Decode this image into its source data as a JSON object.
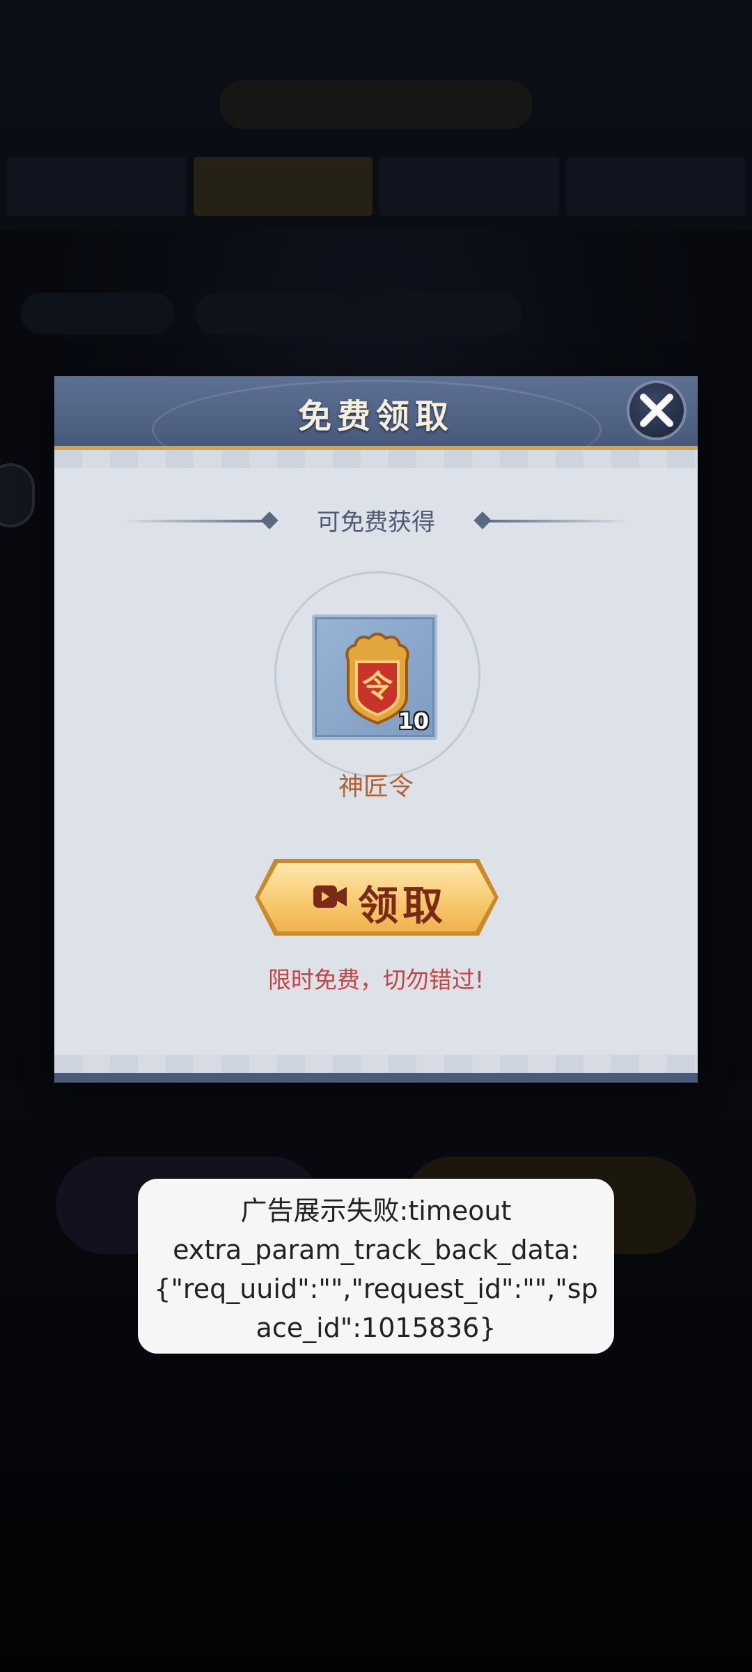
{
  "modal": {
    "title": "免费领取",
    "section_title": "可免费获得",
    "item": {
      "name": "神匠令",
      "count": "10",
      "glyph": "令"
    },
    "claim_button_label": "领取",
    "limit_text": "限时免费，切勿错过!"
  },
  "toast": {
    "lines": [
      "广告展示失败:timeout",
      "extra_param_track_back_data:",
      "{\"req_uuid\":\"\",\"request_id\":\"\",\"sp",
      "ace_id\":1015836}"
    ]
  },
  "colors": {
    "header": "#485a7c",
    "modal_body": "#dde1e8",
    "item_name": "#b4612f",
    "limit_text": "#c74444",
    "button_gold": "#f7c86b"
  },
  "icons": {
    "close": "close-x-icon",
    "video": "video-camera-icon",
    "item": "token-badge-icon"
  }
}
